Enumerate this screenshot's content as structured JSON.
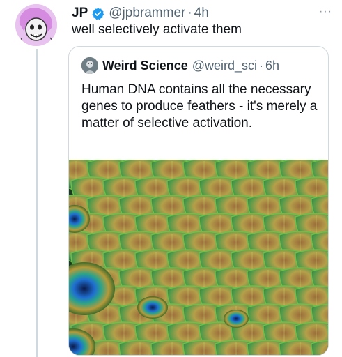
{
  "tweet": {
    "author_name": "JP",
    "author_handle": "@jpbrammer",
    "separator": "·",
    "time": "4h",
    "text": "well selectively activate them",
    "more_label": "···",
    "avatar_icon": "cartoon-skull-avatar-icon",
    "verified_icon": "verified-badge-icon",
    "verified_color": "#1d9bf0"
  },
  "quote": {
    "author_name": "Weird Science",
    "author_handle": "@weird_sci",
    "separator": "·",
    "time": "6h",
    "text": "Human DNA contains all the necessary genes to produce feathers - it's merely a matter of selective activation.",
    "avatar_icon": "science-avatar-icon",
    "media_description_icon": "peacock-feathers-image"
  },
  "colors": {
    "text_primary": "#0f1419",
    "text_secondary": "#536471",
    "border": "#cfd9de"
  }
}
